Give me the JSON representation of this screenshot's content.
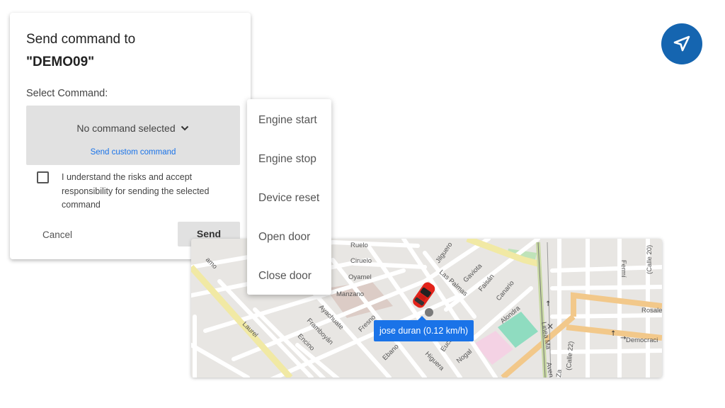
{
  "dialog": {
    "title": "Send command to",
    "device": "\"DEMO09\"",
    "select_label": "Select Command:",
    "selected_value": "No command selected",
    "custom_link": "Send custom command",
    "ack_text": "I understand the risks and accept responsibility for sending the selected command",
    "ack_checked": false,
    "cancel_label": "Cancel",
    "send_label": "Send"
  },
  "menu": {
    "items": [
      "Engine start",
      "Engine stop",
      "Device reset",
      "Open door",
      "Close door"
    ]
  },
  "nav_button": {
    "icon": "navigation-arrow-icon",
    "color": "#1565b0"
  },
  "map": {
    "popup": "jose duran (0.12 km/h)",
    "streets": [
      "Ciruelo",
      "Oyamel",
      "Manzano",
      "Jilguero",
      "Las Palmas",
      "Gaviota",
      "Faisán",
      "Canario",
      "Alondra",
      "Ayachuate",
      "Framboyán",
      "Encino",
      "Laurel",
      "Fresno",
      "Ebano",
      "Higuera",
      "Eucal",
      "Nogal",
      "Fermí",
      "(Calle 20)",
      "Rosale",
      "Democraci",
      "Linea Ma",
      "(Calle 22)",
      "Aven",
      "amo",
      "Za",
      "Ruelo"
    ]
  }
}
